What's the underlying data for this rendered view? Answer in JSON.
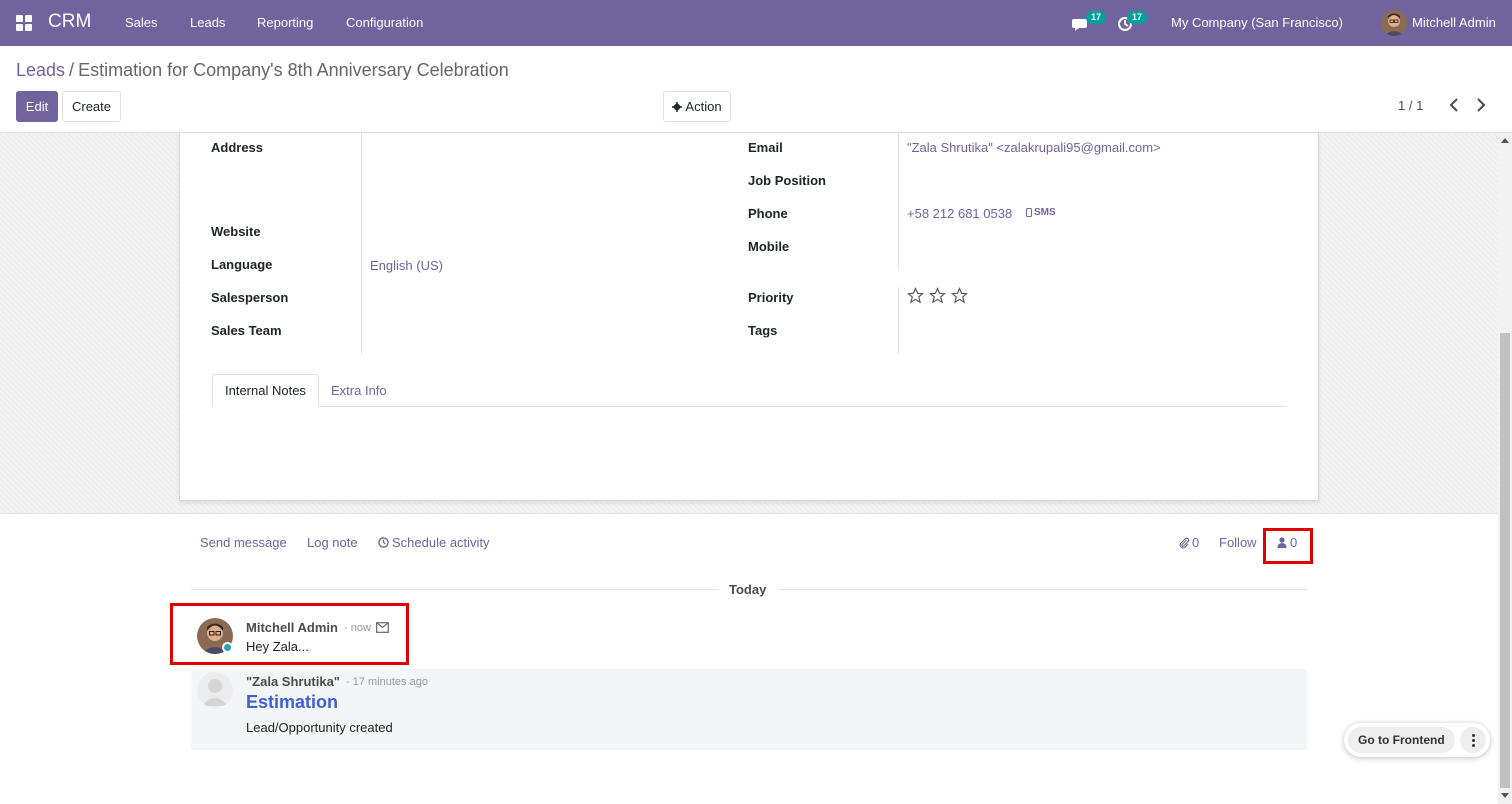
{
  "navbar": {
    "brand": "CRM",
    "menu": [
      "Sales",
      "Leads",
      "Reporting",
      "Configuration"
    ],
    "messages_count": "17",
    "activities_count": "17",
    "company": "My Company (San Francisco)",
    "user": "Mitchell Admin"
  },
  "control": {
    "breadcrumb_parent": "Leads",
    "breadcrumb_separator": "/",
    "breadcrumb_current": "Estimation for Company's 8th Anniversary Celebration",
    "edit_label": "Edit",
    "create_label": "Create",
    "action_label": "Action",
    "pager": "1 / 1"
  },
  "form": {
    "left_labels": {
      "address": "Address",
      "website": "Website",
      "language": "Language",
      "salesperson": "Salesperson",
      "sales_team": "Sales Team"
    },
    "language_value": "English (US)",
    "right_labels": {
      "email": "Email",
      "job_position": "Job Position",
      "phone": "Phone",
      "mobile": "Mobile",
      "priority": "Priority",
      "tags": "Tags"
    },
    "email_value": "\"Zala Shrutika\" <zalakrupali95@gmail.com>",
    "phone_value": "+58 212 681 0538",
    "sms_label": "SMS",
    "priority_stars": 0,
    "tabs": [
      "Internal Notes",
      "Extra Info"
    ]
  },
  "chatter": {
    "send_message": "Send message",
    "log_note": "Log note",
    "schedule_activity": "Schedule activity",
    "attachments_count": "0",
    "follow": "Follow",
    "followers_count": "0",
    "today": "Today",
    "messages": [
      {
        "author": "Mitchell Admin",
        "date": "- now",
        "body": "Hey Zala..."
      },
      {
        "author": "\"Zala Shrutika\"",
        "date": "- 17 minutes ago",
        "title": "Estimation",
        "body": "Lead/Opportunity created"
      }
    ]
  },
  "frontend": {
    "label": "Go to Frontend"
  },
  "colors": {
    "brand": "#71639e",
    "highlight": "#e00000"
  }
}
